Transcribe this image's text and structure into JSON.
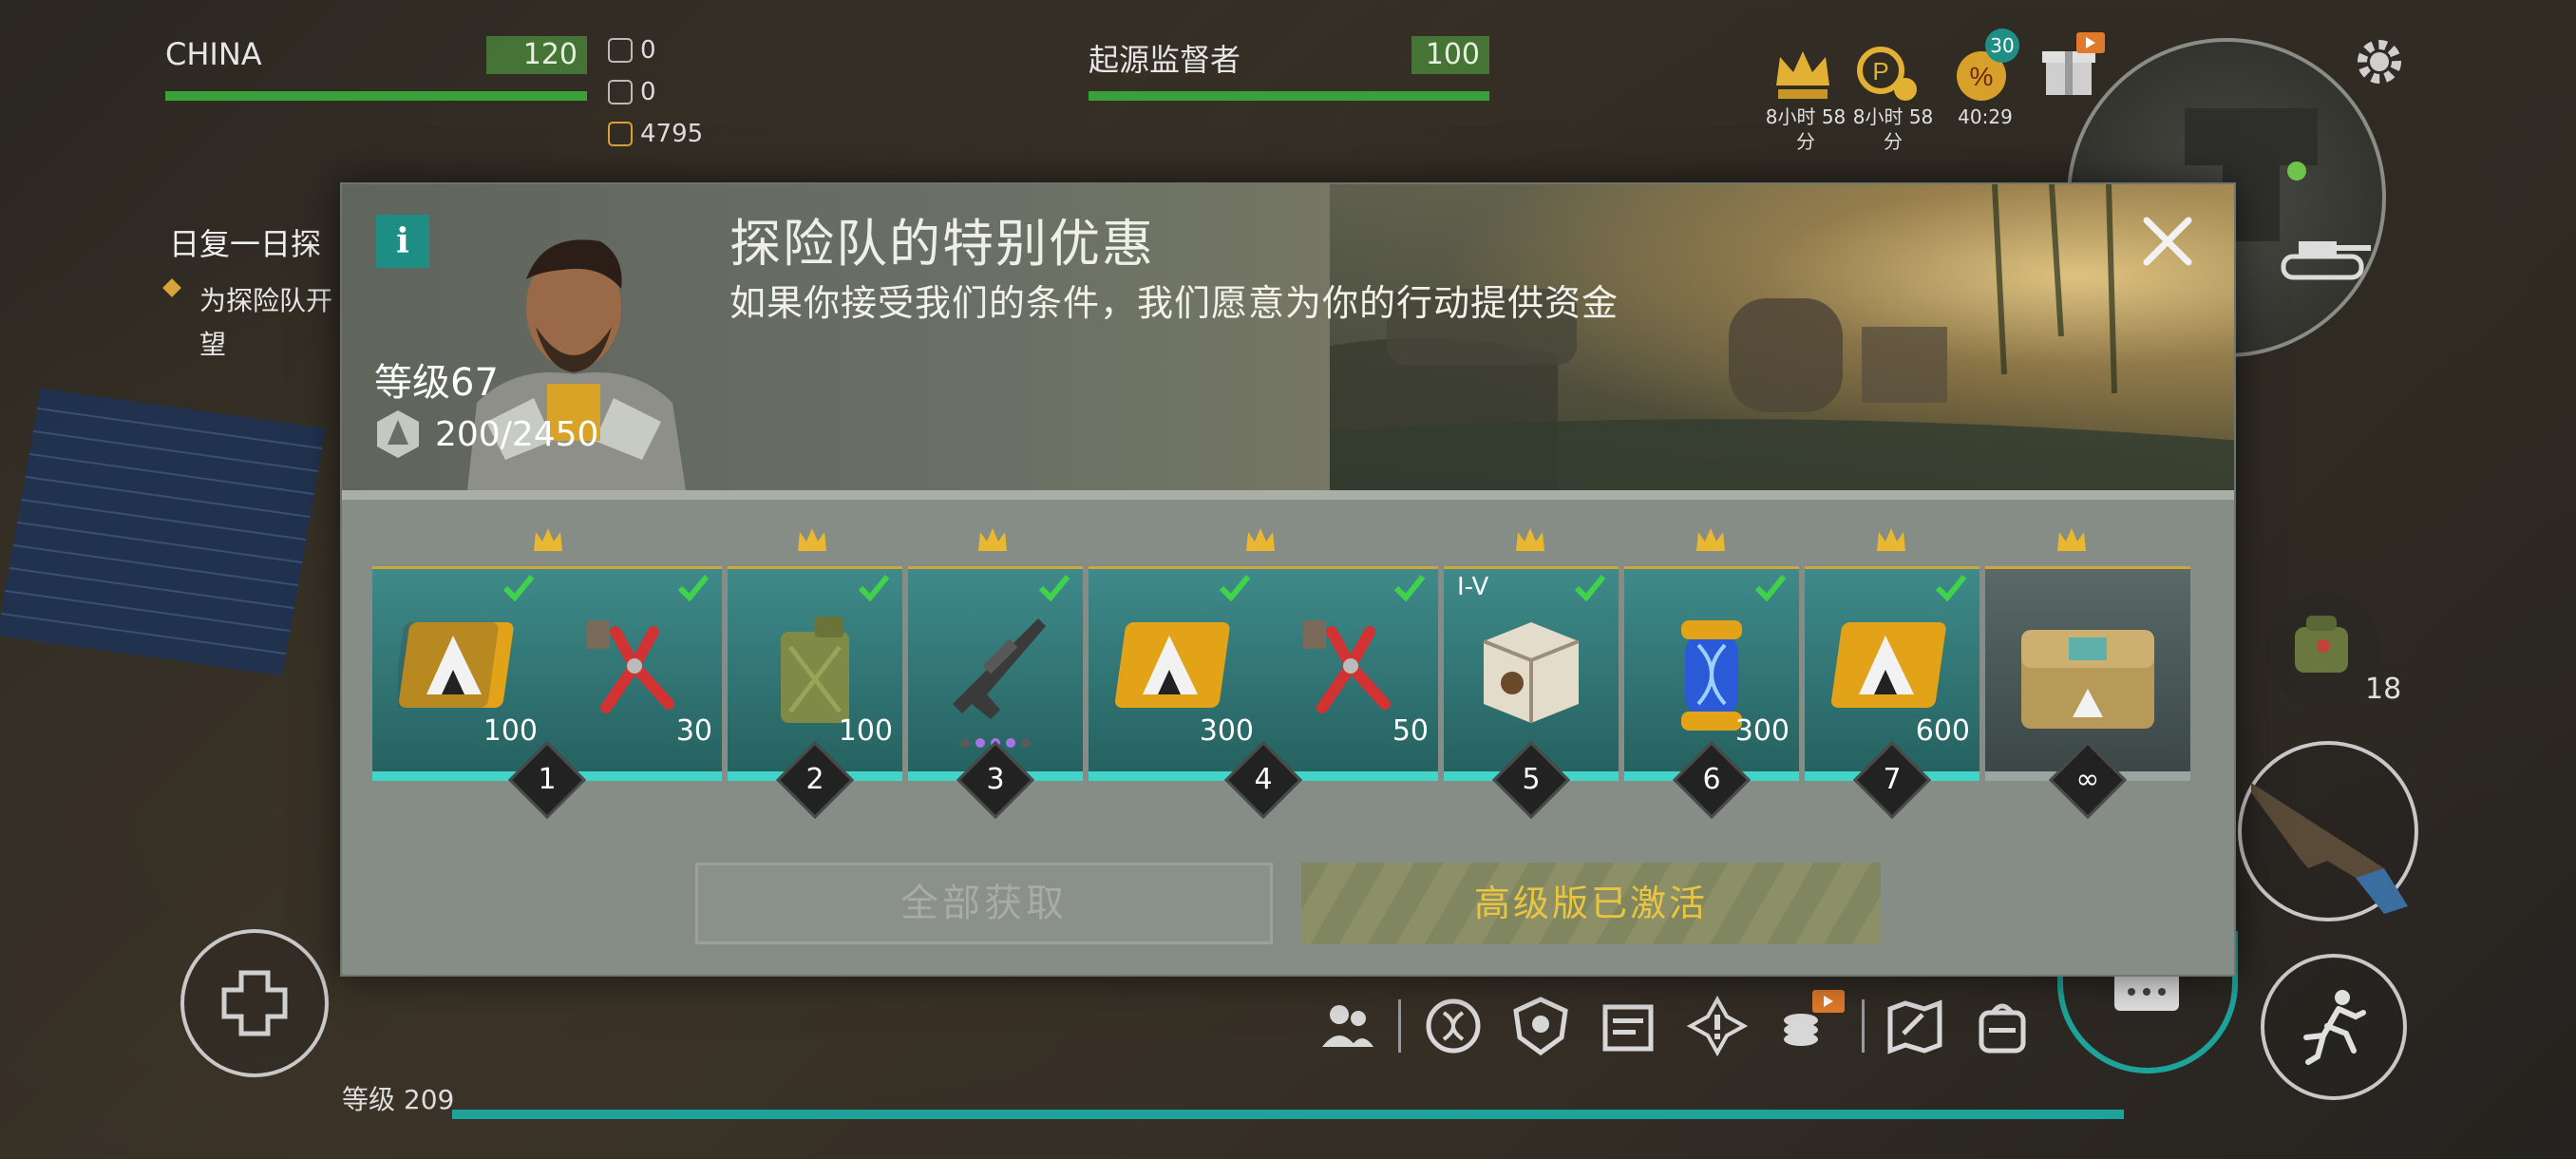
{
  "hud": {
    "player1": {
      "name": "CHINA",
      "hp": "120"
    },
    "player2": {
      "name": "起源监督者",
      "hp": "100"
    },
    "resources": [
      {
        "icon": "flag-icon",
        "value": "0"
      },
      {
        "icon": "scroll-icon",
        "value": "0"
      },
      {
        "icon": "coin-icon",
        "value": "4795"
      }
    ],
    "timers": [
      {
        "line1": "8小时 58",
        "line2": "分"
      },
      {
        "line1": "8小时 58",
        "line2": "分"
      },
      {
        "line1": "40:29",
        "line2": ""
      }
    ],
    "discount_badge": "30",
    "quest": {
      "title": "日复一日探",
      "line1": "为探险队开",
      "line2": "望"
    },
    "backpack_count": "18",
    "level_label": "等级 209"
  },
  "modal": {
    "title": "探险队的特别优惠",
    "description": "如果你接受我们的条件，我们愿意为你的行动提供资金",
    "level": "等级67",
    "xp": "200/2450",
    "claim_all_label": "全部获取",
    "premium_label": "高级版已激活",
    "tiers": [
      {
        "num": "1",
        "items": [
          {
            "icon": "adidas-token-icon",
            "qty": "100"
          },
          {
            "icon": "pliers-icon",
            "qty": "30"
          }
        ]
      },
      {
        "num": "2",
        "items": [
          {
            "icon": "jerrycan-icon",
            "qty": "100"
          }
        ]
      },
      {
        "num": "3",
        "items": [
          {
            "icon": "rifle-icon",
            "qty": ""
          }
        ]
      },
      {
        "num": "4",
        "items": [
          {
            "icon": "adidas-token-icon",
            "qty": "300"
          },
          {
            "icon": "pliers-icon",
            "qty": "50"
          }
        ]
      },
      {
        "num": "5",
        "roman": "I-V",
        "items": [
          {
            "icon": "crate-icon",
            "qty": ""
          }
        ]
      },
      {
        "num": "6",
        "items": [
          {
            "icon": "dna-capsule-icon",
            "qty": "300"
          }
        ]
      },
      {
        "num": "7",
        "items": [
          {
            "icon": "adidas-token-icon",
            "qty": "600"
          }
        ]
      },
      {
        "num": "∞",
        "items": [
          {
            "icon": "chest-icon",
            "qty": ""
          }
        ]
      }
    ]
  },
  "colors": {
    "accent_teal": "#1e8e84",
    "gold": "#e9c541",
    "check_green": "#3fd24a",
    "hp_green": "#3aa03a"
  }
}
